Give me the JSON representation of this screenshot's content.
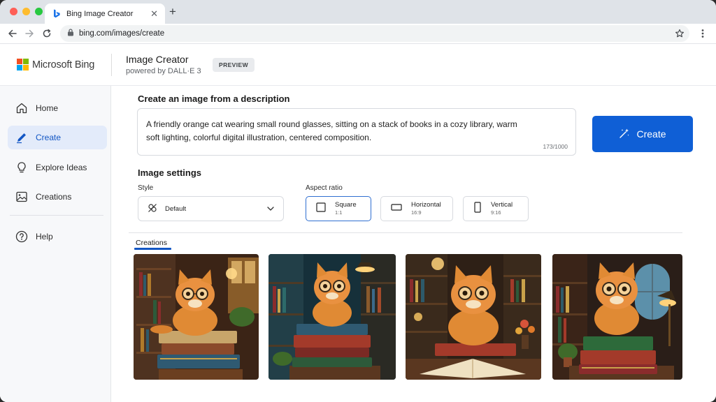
{
  "browser": {
    "tab_title": "Bing Image Creator",
    "url": "bing.com/images/create"
  },
  "header": {
    "brand": "Microsoft Bing",
    "app_title": "Image Creator",
    "app_subtitle": "powered by DALL·E 3",
    "badge": "PREVIEW"
  },
  "sidebar": {
    "items": [
      {
        "label": "Home",
        "icon": "home-icon"
      },
      {
        "label": "Create",
        "icon": "pen-icon",
        "active": true
      },
      {
        "label": "Explore Ideas",
        "icon": "lightbulb-icon"
      },
      {
        "label": "Creations",
        "icon": "image-icon"
      },
      {
        "label": "Help",
        "icon": "help-icon"
      }
    ]
  },
  "main": {
    "create_heading": "Create an image from a description",
    "prompt": "A friendly orange cat wearing small round glasses, sitting on a stack of books in a cozy library, warm soft lighting, colorful digital illustration, centered composition.",
    "char_count": "173/1000",
    "create_button": "Create",
    "settings_heading": "Image settings",
    "style_label": "Style",
    "style_value": "Default",
    "aspect_label": "Aspect ratio",
    "ratios": [
      {
        "name": "Square",
        "dim": "1:1",
        "selected": true
      },
      {
        "name": "Horizontal",
        "dim": "16:9",
        "selected": false
      },
      {
        "name": "Vertical",
        "dim": "9:16",
        "selected": false
      }
    ],
    "creations_tab": "Creations",
    "images": [
      {
        "subject": "orange cat with glasses on books in library"
      },
      {
        "subject": "orange cat with glasses on books in library"
      },
      {
        "subject": "orange cat with glasses on open book in library"
      },
      {
        "subject": "orange cat with glasses on books beside lamp and window"
      }
    ]
  },
  "colors": {
    "accent": "#0f5fd6",
    "active_nav_bg": "#e3ebfa",
    "ms_red": "#f25022",
    "ms_green": "#7fba00",
    "ms_blue": "#00a4ef",
    "ms_yellow": "#ffb900"
  }
}
